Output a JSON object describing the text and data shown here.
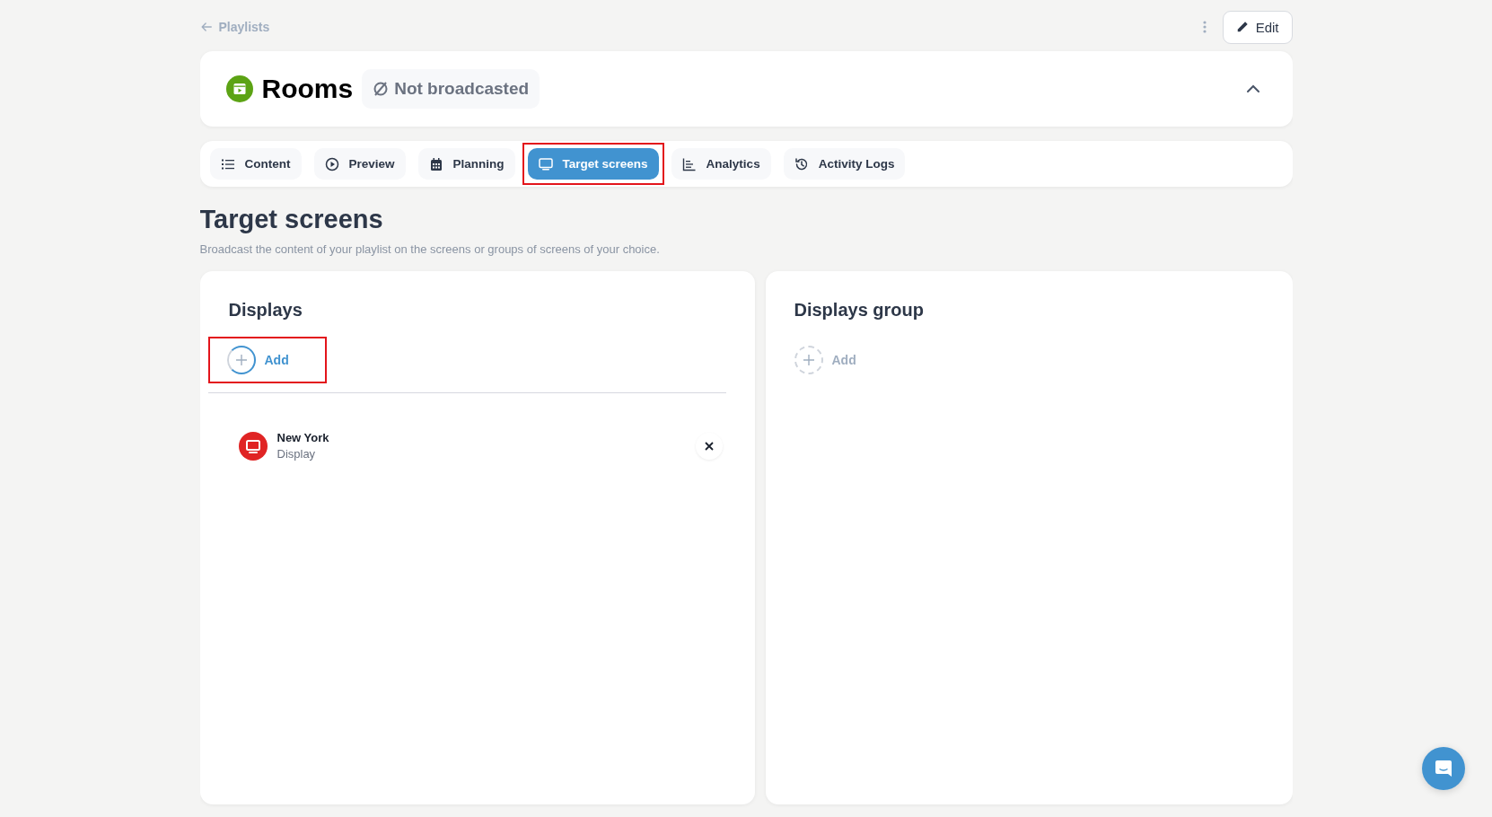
{
  "breadcrumb": {
    "label": "Playlists"
  },
  "edit_button": {
    "label": "Edit"
  },
  "header": {
    "title": "Rooms",
    "status": "Not broadcasted",
    "expanded": true
  },
  "tabs": [
    {
      "label": "Content",
      "selected": false,
      "highlighted": false
    },
    {
      "label": "Preview",
      "selected": false,
      "highlighted": false
    },
    {
      "label": "Planning",
      "selected": false,
      "highlighted": false
    },
    {
      "label": "Target screens",
      "selected": true,
      "highlighted": true
    },
    {
      "label": "Analytics",
      "selected": false,
      "highlighted": false
    },
    {
      "label": "Activity Logs",
      "selected": false,
      "highlighted": false
    }
  ],
  "page": {
    "title": "Target screens",
    "subtitle": "Broadcast the content of your playlist on the screens or groups of screens of your choice."
  },
  "panels": [
    {
      "title": "Displays",
      "add": {
        "label": "Add",
        "active": true,
        "highlighted": true
      },
      "items": [
        {
          "name": "New York",
          "type": "Display",
          "color": "#e02424"
        }
      ]
    },
    {
      "title": "Displays group",
      "add": {
        "label": "Add",
        "active": false,
        "highlighted": false
      }
    }
  ]
}
